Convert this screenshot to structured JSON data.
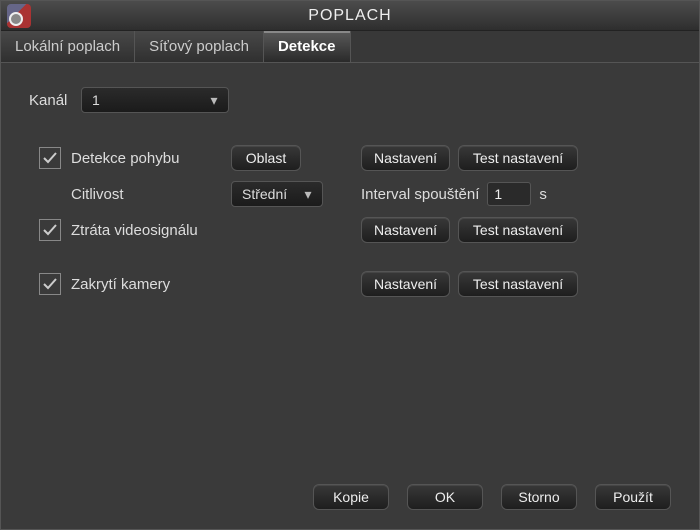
{
  "window": {
    "title": "POPLACH"
  },
  "tabs": {
    "local": "Lokální poplach",
    "network": "Síťový poplach",
    "detection": "Detekce"
  },
  "channel": {
    "label": "Kanál",
    "value": "1"
  },
  "motion": {
    "label": "Detekce pohybu",
    "area_btn": "Oblast",
    "settings_btn": "Nastavení",
    "test_btn": "Test nastavení",
    "sensitivity_label": "Citlivost",
    "sensitivity_value": "Střední",
    "interval_label": "Interval spouštění",
    "interval_value": "1",
    "interval_unit": "s"
  },
  "videoloss": {
    "label": "Ztráta videosignálu",
    "settings_btn": "Nastavení",
    "test_btn": "Test nastavení"
  },
  "cover": {
    "label": "Zakrytí kamery",
    "settings_btn": "Nastavení",
    "test_btn": "Test nastavení"
  },
  "footer": {
    "copy": "Kopie",
    "ok": "OK",
    "cancel": "Storno",
    "apply": "Použít"
  }
}
